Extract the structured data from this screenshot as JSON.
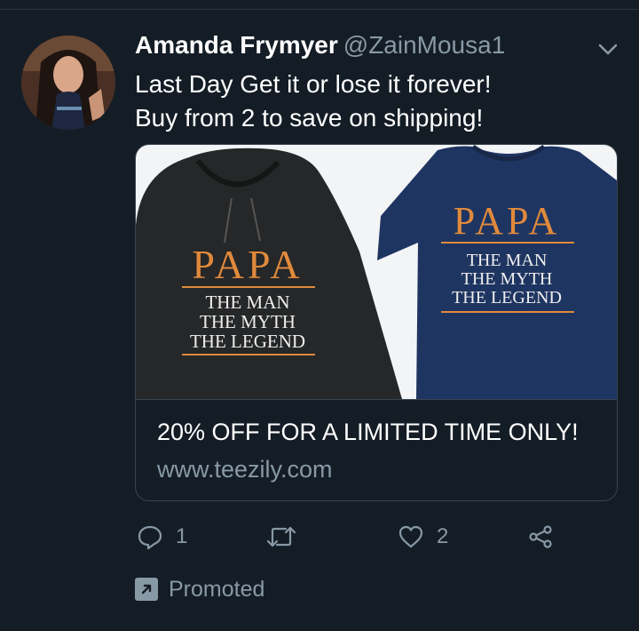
{
  "tweet": {
    "display_name": "Amanda Frymyer",
    "handle": "@ZainMousa1",
    "text_line1": "Last Day Get it or lose it forever!",
    "text_line2": "Buy from 2 to save on shipping!"
  },
  "card": {
    "image": {
      "hoodie_title": "PAPA",
      "hoodie_line1": "THE MAN",
      "hoodie_line2": "THE MYTH",
      "hoodie_line3": "THE LEGEND",
      "tee_title": "PAPA",
      "tee_line1": "THE MAN",
      "tee_line2": "THE MYTH",
      "tee_line3": "THE LEGEND"
    },
    "title": "20% OFF FOR A LIMITED TIME ONLY!",
    "url": "www.teezily.com"
  },
  "actions": {
    "reply_count": "1",
    "like_count": "2"
  },
  "promoted_label": "Promoted",
  "colors": {
    "background": "#141d26",
    "muted": "#8899a6",
    "border": "#38444d",
    "print_orange": "#e08a3c"
  }
}
